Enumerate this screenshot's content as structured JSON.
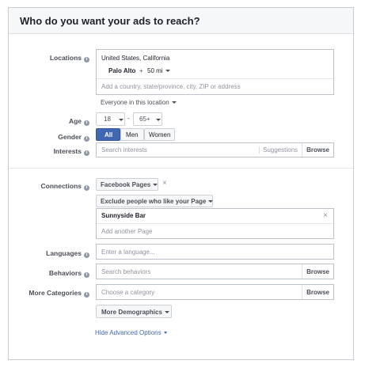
{
  "header": {
    "title": "Who do you want your ads to reach?"
  },
  "locations": {
    "label": "Locations",
    "country": "United States, California",
    "city": "Palo Alto",
    "plus": "+",
    "radius": "50 mi",
    "placeholder": "Add a country, state/province, city, ZIP or address",
    "scope": "Everyone in this location"
  },
  "age": {
    "label": "Age",
    "min": "18",
    "dash": "-",
    "max": "65+"
  },
  "gender": {
    "label": "Gender",
    "options": [
      "All",
      "Men",
      "Women"
    ],
    "selected": "All"
  },
  "interests": {
    "label": "Interests",
    "placeholder": "Search interests",
    "suggestions": "Suggestions",
    "browse": "Browse"
  },
  "connections": {
    "label": "Connections",
    "type": "Facebook Pages",
    "exclude": "Exclude people who like your Page",
    "page": "Sunnyside Bar",
    "add_placeholder": "Add another Page"
  },
  "languages": {
    "label": "Languages",
    "placeholder": "Enter a language..."
  },
  "behaviors": {
    "label": "Behaviors",
    "placeholder": "Search behaviors",
    "browse": "Browse"
  },
  "more_categories": {
    "label": "More Categories",
    "placeholder": "Choose a category",
    "browse": "Browse"
  },
  "more_demographics": "More Demographics",
  "hide_advanced": "Hide Advanced Options",
  "colors": {
    "accent": "#4267b2",
    "selected": "#4267b2"
  }
}
